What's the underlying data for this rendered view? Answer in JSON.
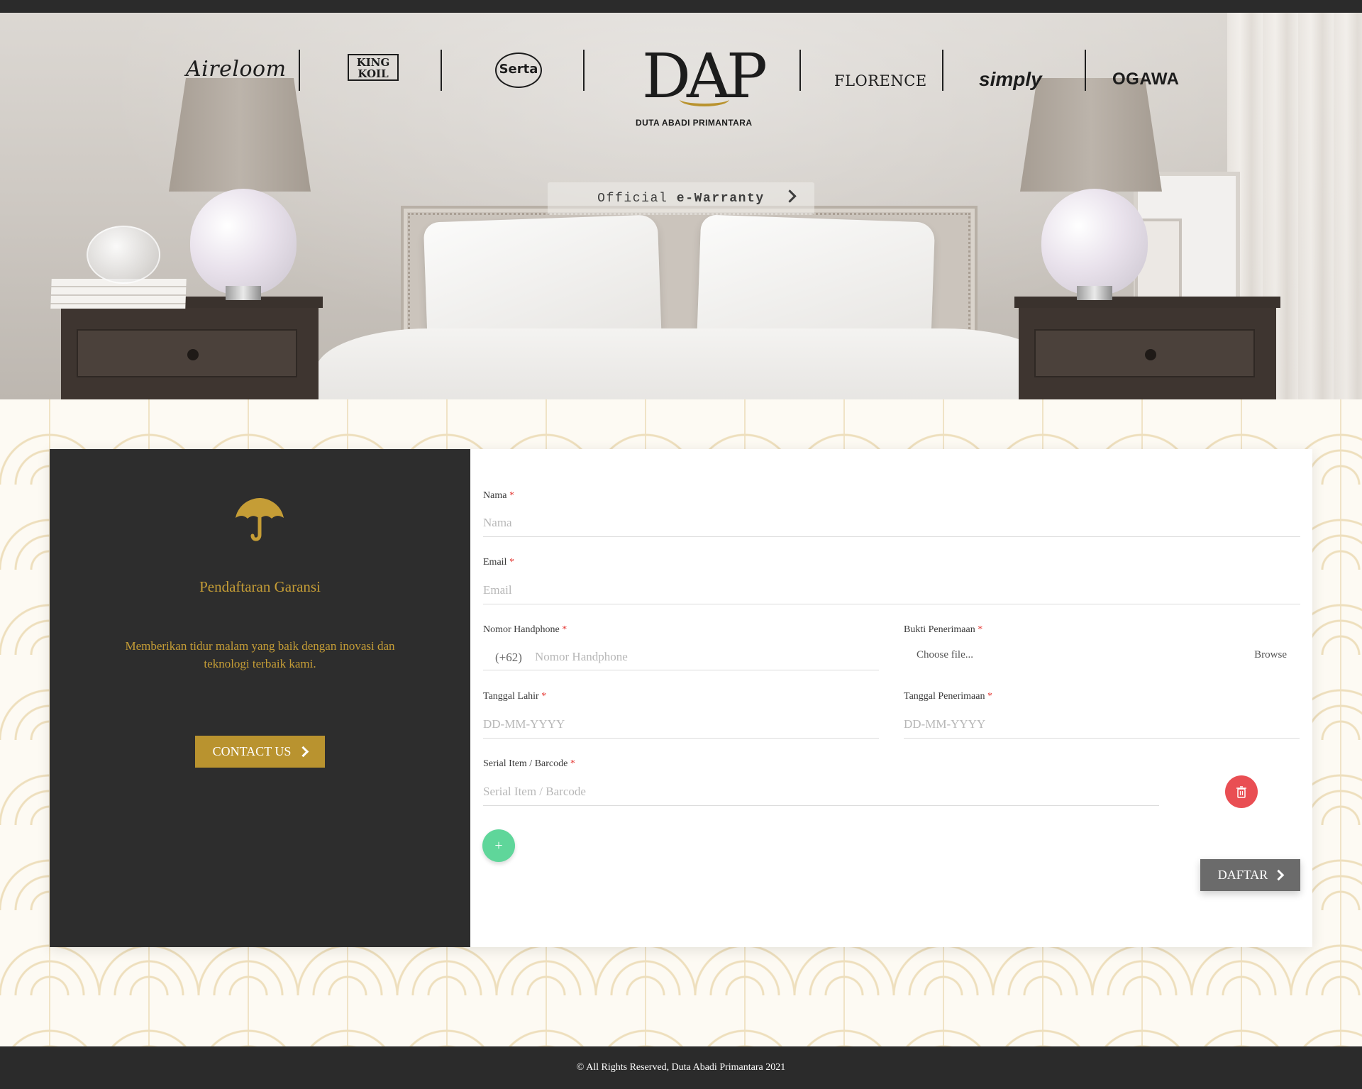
{
  "brands": {
    "aireloom": "Aireloom",
    "king_koil": "KING KOIL",
    "serta": "Serta",
    "dap_mark": "DAP",
    "dap_name": "DUTA ABADI PRIMANTARA",
    "florence": "FLORENCE",
    "simply": "simply",
    "ogawa": "OGAWA"
  },
  "hero": {
    "warranty_prefix": "Official ",
    "warranty_bold": "e-Warranty"
  },
  "sidebar": {
    "title": "Pendaftaran Garansi",
    "description": "Memberikan tidur malam yang baik dengan inovasi dan teknologi terbaik kami.",
    "contact_label": "CONTACT US"
  },
  "form": {
    "required_mark": "*",
    "nama": {
      "label": "Nama",
      "placeholder": "Nama"
    },
    "email": {
      "label": "Email",
      "placeholder": "Email"
    },
    "phone": {
      "label": "Nomor Handphone",
      "prefix": "(+62)",
      "placeholder": "Nomor Handphone"
    },
    "receipt": {
      "label": "Bukti Penerimaan",
      "file_text": "Choose file...",
      "browse": "Browse"
    },
    "birth_date": {
      "label": "Tanggal Lahir",
      "placeholder": "DD-MM-YYYY"
    },
    "receive_date": {
      "label": "Tanggal Penerimaan",
      "placeholder": "DD-MM-YYYY"
    },
    "serial": {
      "label": "Serial Item / Barcode",
      "placeholder": "Serial Item / Barcode"
    },
    "add_label": "+",
    "submit_label": "DAFTAR"
  },
  "footer": {
    "copyright": "© All Rights Reserved, Duta Abadi Primantara 2021"
  },
  "colors": {
    "gold": "#b9932f",
    "dark": "#2d2d2d",
    "delete": "#e94e53",
    "add": "#5fd69a",
    "required": "#e53935"
  },
  "icons": {
    "umbrella": "umbrella-icon",
    "trash": "trash-icon",
    "chevron": "chevron-right-icon"
  }
}
